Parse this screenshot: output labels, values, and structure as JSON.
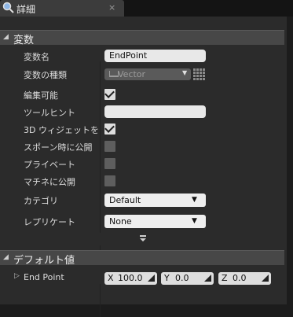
{
  "tab": {
    "title": "詳細",
    "close": "×"
  },
  "sections": {
    "variable": {
      "title": "変数",
      "rows": {
        "name": {
          "label": "変数名",
          "value": "EndPoint"
        },
        "type": {
          "label": "変数の種類",
          "value": "Vector"
        },
        "editable": {
          "label": "編集可能",
          "checked": true
        },
        "tooltip": {
          "label": "ツールヒント",
          "value": ""
        },
        "widget3d": {
          "label": "3D ウィジェットを",
          "checked": true
        },
        "spawn": {
          "label": "スポーン時に公開",
          "checked": false
        },
        "private": {
          "label": "プライベート",
          "checked": false
        },
        "matinee": {
          "label": "マチネに公開",
          "checked": false
        },
        "category": {
          "label": "カテゴリ",
          "value": "Default"
        },
        "replicate": {
          "label": "レプリケート",
          "value": "None"
        }
      }
    },
    "defaults": {
      "title": "デフォルト値",
      "endpoint": {
        "label": "End Point",
        "x": {
          "axis": "X",
          "value": "100.0"
        },
        "y": {
          "axis": "Y",
          "value": "0.0"
        },
        "z": {
          "axis": "Z",
          "value": "0.0"
        }
      }
    }
  },
  "icons": {
    "tab": "details-icon",
    "type_grid": "grid-icon",
    "expand": "expand-arrow-icon",
    "endpoint_toggle": "expand-triangle-icon"
  },
  "colors": {
    "panel": "#2b2b2b",
    "header": "#474747",
    "field": "#e8e8e8"
  }
}
